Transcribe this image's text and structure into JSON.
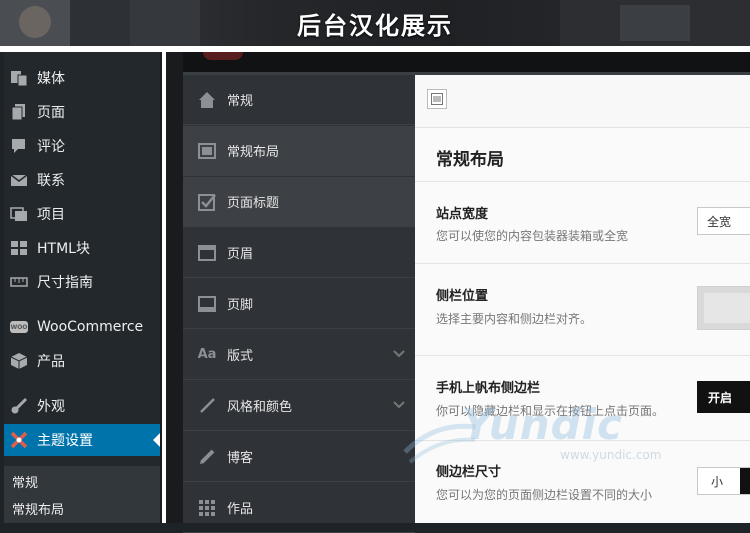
{
  "banner": {
    "title": "后台汉化展示"
  },
  "wp_menu": {
    "items": [
      {
        "label": "媒体",
        "icon": "media-icon"
      },
      {
        "label": "页面",
        "icon": "page-icon"
      },
      {
        "label": "评论",
        "icon": "comment-icon"
      },
      {
        "label": "联系",
        "icon": "mail-icon"
      },
      {
        "label": "项目",
        "icon": "portfolio-icon"
      },
      {
        "label": "HTML块",
        "icon": "html-block-icon"
      },
      {
        "label": "尺寸指南",
        "icon": "ruler-icon"
      },
      {
        "label": "WooCommerce",
        "icon": "woocommerce-icon"
      },
      {
        "label": "产品",
        "icon": "product-box-icon"
      },
      {
        "label": "外观",
        "icon": "brush-icon"
      },
      {
        "label": "主题设置",
        "icon": "theme-settings-icon"
      }
    ],
    "active_index": 10,
    "active_color": "#0073aa",
    "submenu": [
      "常规",
      "常规布局"
    ]
  },
  "ts_nav": {
    "items": [
      {
        "label": "常规",
        "icon": "home-icon"
      },
      {
        "label": "常规布局",
        "icon": "layout-icon"
      },
      {
        "label": "页面标题",
        "icon": "checkbox-icon"
      },
      {
        "label": "页眉",
        "icon": "header-icon"
      },
      {
        "label": "页脚",
        "icon": "footer-icon"
      },
      {
        "label": "版式",
        "icon": "typography-icon",
        "expandable": true
      },
      {
        "label": "风格和颜色",
        "icon": "pen-icon",
        "expandable": true
      },
      {
        "label": "博客",
        "icon": "pencil-icon"
      },
      {
        "label": "作品",
        "icon": "grid-icon"
      }
    ],
    "selected_index": 1
  },
  "content": {
    "section_title": "常规布局",
    "options": [
      {
        "label": "站点宽度",
        "desc": "您可以使您的内容包装器装箱或全宽",
        "control": "全宽"
      },
      {
        "label": "侧栏位置",
        "desc": "选择主要内容和侧边栏对齐。",
        "control": ""
      },
      {
        "label": "手机上帆布侧边栏",
        "desc": "你可以隐藏边栏和显示在按钮上点击页面。",
        "control": "开启"
      },
      {
        "label": "侧边栏尺寸",
        "desc": "您可以为您的页面侧边栏设置不同的大小",
        "control": "小"
      }
    ]
  },
  "watermark": {
    "brand": "Yundic",
    "url": "www.yundic.com"
  }
}
